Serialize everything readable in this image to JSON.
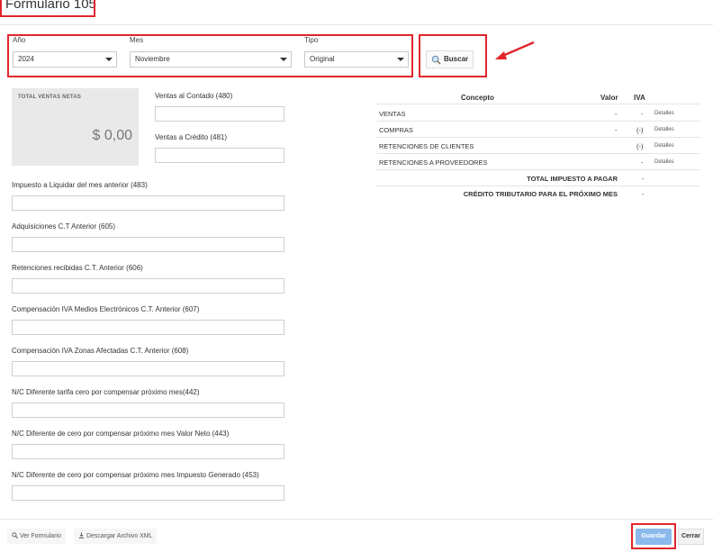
{
  "page": {
    "title": "Formulario 105"
  },
  "filters": {
    "year_label": "Año",
    "year_value": "2024",
    "month_label": "Mes",
    "month_value": "Noviembre",
    "type_label": "Tipo",
    "type_value": "Original",
    "search_label": "Buscar"
  },
  "summary": {
    "total_label": "TOTAL VENTAS NETAS",
    "total_amount": "$ 0,00"
  },
  "fields": {
    "ventas_contado": "Ventas al Contado (480)",
    "ventas_credito": "Ventas a Crédito (481)",
    "impuesto_liquidar": "Impuesto a Liquidar del mes anterior (483)",
    "adquisiciones": "Adquisiciones C.T Anterior (605)",
    "retenciones_recibidas": "Retenciones recibidas C.T. Anterior (606)",
    "compensacion_medios": "Compensación IVA Medios Electrónicos C.T. Anterior (607)",
    "compensacion_zonas": "Compensación IVA Zonas Afectadas C.T. Anterior (608)",
    "nc_tarifa_cero": "N/C Diferente tarifa cero por compensar próximo mes(442)",
    "nc_valor_neto": "N/C Diferente de cero por compensar próximo mes Valor Neto (443)",
    "nc_impuesto_generado": "N/C Diferente de cero por compensar próximo mes Impuesto Generado (453)"
  },
  "table": {
    "headers": {
      "concepto": "Concepto",
      "valor": "Valor",
      "iva": "IVA"
    },
    "rows": [
      {
        "concepto": "VENTAS",
        "valor": "-",
        "iva": "-",
        "action": "Detalles"
      },
      {
        "concepto": "COMPRAS",
        "valor": "-",
        "iva": "(-)",
        "action": "Detalles"
      },
      {
        "concepto": "RETENCIONES DE CLIENTES",
        "valor": "",
        "iva": "(-)",
        "action": "Detalles"
      },
      {
        "concepto": "RETENCIONES A PROVEEDORES",
        "valor": "",
        "iva": "-",
        "action": "Detalles"
      }
    ],
    "total_impuesto_label": "TOTAL IMPUESTO A PAGAR",
    "total_impuesto_value": "-",
    "credito_label": "CRÉDITO TRIBUTARIO PARA EL PRÓXIMO MES",
    "credito_value": "-"
  },
  "footer": {
    "ver_formulario": "Ver Formulario",
    "descargar_xml": "Descargar Archivo XML",
    "guardar": "Guardar",
    "cerrar": "Cerrar"
  },
  "colors": {
    "highlight": "#e0262c",
    "primary_button": "#8bb9ec"
  }
}
